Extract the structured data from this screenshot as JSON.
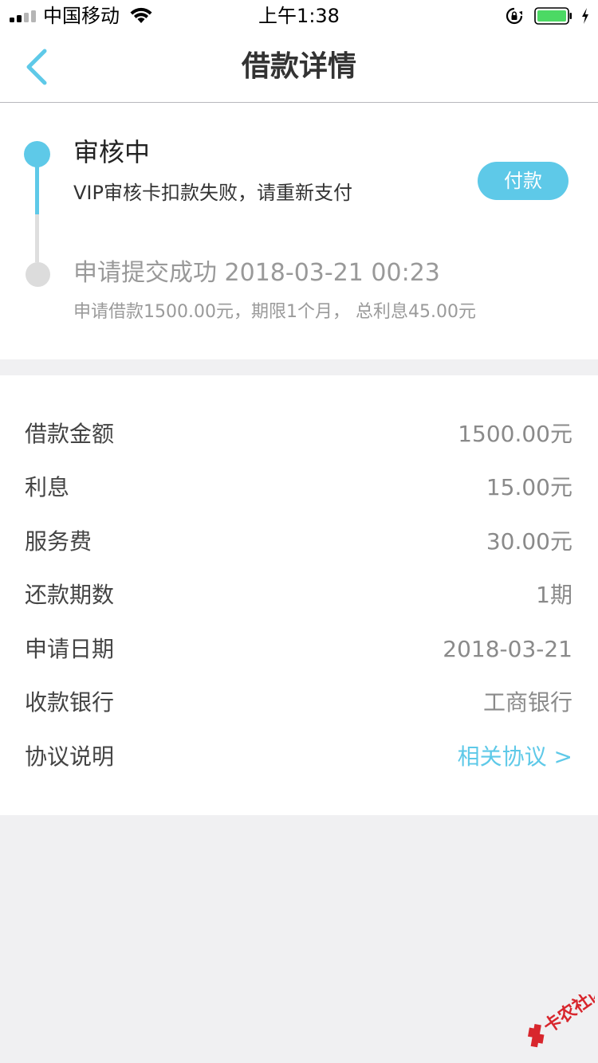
{
  "status_bar": {
    "carrier": "中国移动",
    "time": "上午1:38"
  },
  "nav": {
    "title": "借款详情"
  },
  "progress": {
    "current_step": {
      "title": "审核中",
      "description": "VIP审核卡扣款失败，请重新支付",
      "action_label": "付款"
    },
    "previous_step": {
      "title": "申请提交成功 2018-03-21 00:23",
      "description": "申请借款1500.00元，期限1个月， 总利息45.00元"
    }
  },
  "details": {
    "rows": [
      {
        "label": "借款金额",
        "value": "1500.00元"
      },
      {
        "label": "利息",
        "value": "15.00元"
      },
      {
        "label": "服务费",
        "value": "30.00元"
      },
      {
        "label": "还款期数",
        "value": "1期"
      },
      {
        "label": "申请日期",
        "value": "2018-03-21"
      },
      {
        "label": "收款银行",
        "value": "工商银行"
      },
      {
        "label": "协议说明",
        "value": "相关协议 >"
      }
    ]
  },
  "watermark": {
    "text": "卡农社区"
  },
  "colors": {
    "accent": "#5ec9e8",
    "battery": "#4cd964",
    "watermark": "#d8262d"
  }
}
